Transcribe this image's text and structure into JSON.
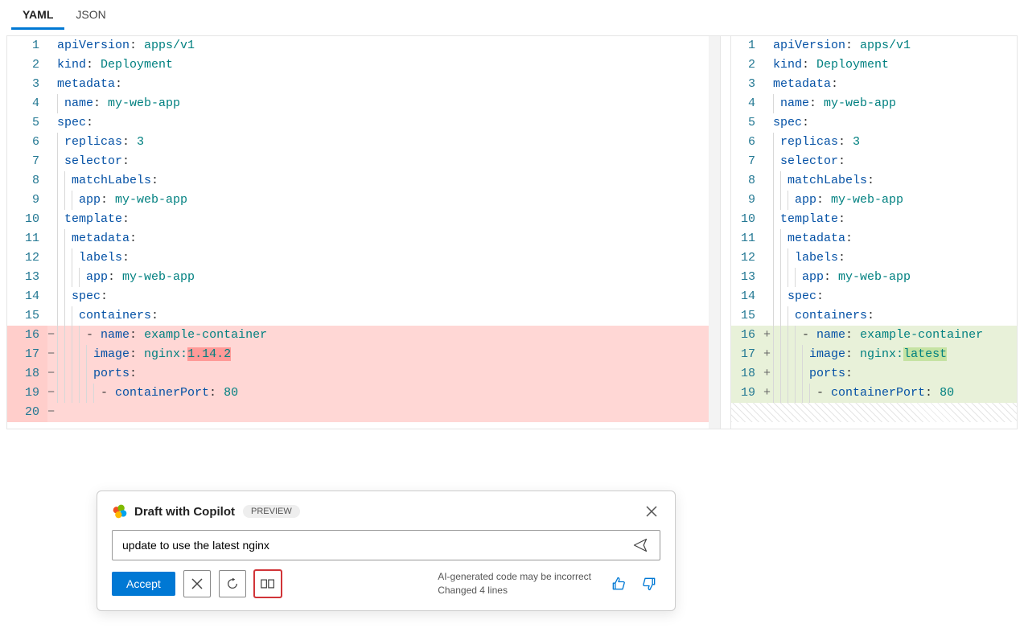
{
  "tabs": {
    "yaml": "YAML",
    "json": "JSON"
  },
  "left_pane": {
    "lines": [
      {
        "n": 1,
        "sign": "",
        "indent": 0,
        "segs": [
          {
            "t": "apiVersion",
            "c": "tok-key"
          },
          {
            "t": ":",
            "c": "tok-punct"
          },
          {
            "t": " "
          },
          {
            "t": "apps/v1",
            "c": "tok-scalar"
          }
        ]
      },
      {
        "n": 2,
        "sign": "",
        "indent": 0,
        "segs": [
          {
            "t": "kind",
            "c": "tok-key"
          },
          {
            "t": ":",
            "c": "tok-punct"
          },
          {
            "t": " "
          },
          {
            "t": "Deployment",
            "c": "tok-scalar"
          }
        ]
      },
      {
        "n": 3,
        "sign": "",
        "indent": 0,
        "segs": [
          {
            "t": "metadata",
            "c": "tok-key"
          },
          {
            "t": ":",
            "c": "tok-punct"
          }
        ]
      },
      {
        "n": 4,
        "sign": "",
        "indent": 1,
        "segs": [
          {
            "t": "name",
            "c": "tok-key"
          },
          {
            "t": ":",
            "c": "tok-punct"
          },
          {
            "t": " "
          },
          {
            "t": "my-web-app",
            "c": "tok-scalar"
          }
        ]
      },
      {
        "n": 5,
        "sign": "",
        "indent": 0,
        "segs": [
          {
            "t": "spec",
            "c": "tok-key"
          },
          {
            "t": ":",
            "c": "tok-punct"
          }
        ]
      },
      {
        "n": 6,
        "sign": "",
        "indent": 1,
        "segs": [
          {
            "t": "replicas",
            "c": "tok-key"
          },
          {
            "t": ":",
            "c": "tok-punct"
          },
          {
            "t": " "
          },
          {
            "t": "3",
            "c": "tok-scalar"
          }
        ]
      },
      {
        "n": 7,
        "sign": "",
        "indent": 1,
        "segs": [
          {
            "t": "selector",
            "c": "tok-key"
          },
          {
            "t": ":",
            "c": "tok-punct"
          }
        ]
      },
      {
        "n": 8,
        "sign": "",
        "indent": 2,
        "segs": [
          {
            "t": "matchLabels",
            "c": "tok-key"
          },
          {
            "t": ":",
            "c": "tok-punct"
          }
        ]
      },
      {
        "n": 9,
        "sign": "",
        "indent": 3,
        "segs": [
          {
            "t": "app",
            "c": "tok-key"
          },
          {
            "t": ":",
            "c": "tok-punct"
          },
          {
            "t": " "
          },
          {
            "t": "my-web-app",
            "c": "tok-scalar"
          }
        ]
      },
      {
        "n": 10,
        "sign": "",
        "indent": 1,
        "segs": [
          {
            "t": "template",
            "c": "tok-key"
          },
          {
            "t": ":",
            "c": "tok-punct"
          }
        ]
      },
      {
        "n": 11,
        "sign": "",
        "indent": 2,
        "segs": [
          {
            "t": "metadata",
            "c": "tok-key"
          },
          {
            "t": ":",
            "c": "tok-punct"
          }
        ]
      },
      {
        "n": 12,
        "sign": "",
        "indent": 3,
        "segs": [
          {
            "t": "labels",
            "c": "tok-key"
          },
          {
            "t": ":",
            "c": "tok-punct"
          }
        ]
      },
      {
        "n": 13,
        "sign": "",
        "indent": 4,
        "segs": [
          {
            "t": "app",
            "c": "tok-key"
          },
          {
            "t": ":",
            "c": "tok-punct"
          },
          {
            "t": " "
          },
          {
            "t": "my-web-app",
            "c": "tok-scalar"
          }
        ]
      },
      {
        "n": 14,
        "sign": "",
        "indent": 2,
        "segs": [
          {
            "t": "spec",
            "c": "tok-key"
          },
          {
            "t": ":",
            "c": "tok-punct"
          }
        ]
      },
      {
        "n": 15,
        "sign": "",
        "indent": 3,
        "segs": [
          {
            "t": "containers",
            "c": "tok-key"
          },
          {
            "t": ":",
            "c": "tok-punct"
          }
        ]
      },
      {
        "n": 16,
        "sign": "−",
        "indent": 4,
        "cls": "removed",
        "segs": [
          {
            "t": "- ",
            "c": "tok-dash"
          },
          {
            "t": "name",
            "c": "tok-key"
          },
          {
            "t": ":",
            "c": "tok-punct"
          },
          {
            "t": " "
          },
          {
            "t": "example-container",
            "c": "tok-scalar"
          }
        ]
      },
      {
        "n": 17,
        "sign": "−",
        "indent": 5,
        "cls": "removed",
        "segs": [
          {
            "t": "image",
            "c": "tok-key"
          },
          {
            "t": ":",
            "c": "tok-punct"
          },
          {
            "t": " "
          },
          {
            "t": "nginx:",
            "c": "tok-scalar"
          },
          {
            "t": "1.14.2",
            "c": "tok-scalar inline-del"
          }
        ]
      },
      {
        "n": 18,
        "sign": "−",
        "indent": 5,
        "cls": "removed",
        "segs": [
          {
            "t": "ports",
            "c": "tok-key"
          },
          {
            "t": ":",
            "c": "tok-punct"
          }
        ]
      },
      {
        "n": 19,
        "sign": "−",
        "indent": 6,
        "cls": "removed",
        "segs": [
          {
            "t": "- ",
            "c": "tok-dash"
          },
          {
            "t": "containerPort",
            "c": "tok-key"
          },
          {
            "t": ":",
            "c": "tok-punct"
          },
          {
            "t": " "
          },
          {
            "t": "80",
            "c": "tok-scalar"
          }
        ]
      },
      {
        "n": 20,
        "sign": "−",
        "indent": 0,
        "cls": "removed",
        "segs": []
      }
    ]
  },
  "right_pane": {
    "lines": [
      {
        "n": 1,
        "sign": "",
        "indent": 0,
        "segs": [
          {
            "t": "apiVersion",
            "c": "tok-key"
          },
          {
            "t": ":",
            "c": "tok-punct"
          },
          {
            "t": " "
          },
          {
            "t": "apps/v1",
            "c": "tok-scalar"
          }
        ]
      },
      {
        "n": 2,
        "sign": "",
        "indent": 0,
        "segs": [
          {
            "t": "kind",
            "c": "tok-key"
          },
          {
            "t": ":",
            "c": "tok-punct"
          },
          {
            "t": " "
          },
          {
            "t": "Deployment",
            "c": "tok-scalar"
          }
        ]
      },
      {
        "n": 3,
        "sign": "",
        "indent": 0,
        "segs": [
          {
            "t": "metadata",
            "c": "tok-key"
          },
          {
            "t": ":",
            "c": "tok-punct"
          }
        ]
      },
      {
        "n": 4,
        "sign": "",
        "indent": 1,
        "segs": [
          {
            "t": "name",
            "c": "tok-key"
          },
          {
            "t": ":",
            "c": "tok-punct"
          },
          {
            "t": " "
          },
          {
            "t": "my-web-app",
            "c": "tok-scalar"
          }
        ]
      },
      {
        "n": 5,
        "sign": "",
        "indent": 0,
        "segs": [
          {
            "t": "spec",
            "c": "tok-key"
          },
          {
            "t": ":",
            "c": "tok-punct"
          }
        ]
      },
      {
        "n": 6,
        "sign": "",
        "indent": 1,
        "segs": [
          {
            "t": "replicas",
            "c": "tok-key"
          },
          {
            "t": ":",
            "c": "tok-punct"
          },
          {
            "t": " "
          },
          {
            "t": "3",
            "c": "tok-scalar"
          }
        ]
      },
      {
        "n": 7,
        "sign": "",
        "indent": 1,
        "segs": [
          {
            "t": "selector",
            "c": "tok-key"
          },
          {
            "t": ":",
            "c": "tok-punct"
          }
        ]
      },
      {
        "n": 8,
        "sign": "",
        "indent": 2,
        "segs": [
          {
            "t": "matchLabels",
            "c": "tok-key"
          },
          {
            "t": ":",
            "c": "tok-punct"
          }
        ]
      },
      {
        "n": 9,
        "sign": "",
        "indent": 3,
        "segs": [
          {
            "t": "app",
            "c": "tok-key"
          },
          {
            "t": ":",
            "c": "tok-punct"
          },
          {
            "t": " "
          },
          {
            "t": "my-web-app",
            "c": "tok-scalar"
          }
        ]
      },
      {
        "n": 10,
        "sign": "",
        "indent": 1,
        "segs": [
          {
            "t": "template",
            "c": "tok-key"
          },
          {
            "t": ":",
            "c": "tok-punct"
          }
        ]
      },
      {
        "n": 11,
        "sign": "",
        "indent": 2,
        "segs": [
          {
            "t": "metadata",
            "c": "tok-key"
          },
          {
            "t": ":",
            "c": "tok-punct"
          }
        ]
      },
      {
        "n": 12,
        "sign": "",
        "indent": 3,
        "segs": [
          {
            "t": "labels",
            "c": "tok-key"
          },
          {
            "t": ":",
            "c": "tok-punct"
          }
        ]
      },
      {
        "n": 13,
        "sign": "",
        "indent": 4,
        "segs": [
          {
            "t": "app",
            "c": "tok-key"
          },
          {
            "t": ":",
            "c": "tok-punct"
          },
          {
            "t": " "
          },
          {
            "t": "my-web-app",
            "c": "tok-scalar"
          }
        ]
      },
      {
        "n": 14,
        "sign": "",
        "indent": 2,
        "segs": [
          {
            "t": "spec",
            "c": "tok-key"
          },
          {
            "t": ":",
            "c": "tok-punct"
          }
        ]
      },
      {
        "n": 15,
        "sign": "",
        "indent": 3,
        "segs": [
          {
            "t": "containers",
            "c": "tok-key"
          },
          {
            "t": ":",
            "c": "tok-punct"
          }
        ]
      },
      {
        "n": 16,
        "sign": "+",
        "indent": 4,
        "cls": "added",
        "segs": [
          {
            "t": "- ",
            "c": "tok-dash"
          },
          {
            "t": "name",
            "c": "tok-key"
          },
          {
            "t": ":",
            "c": "tok-punct"
          },
          {
            "t": " "
          },
          {
            "t": "example-container",
            "c": "tok-scalar"
          }
        ]
      },
      {
        "n": 17,
        "sign": "+",
        "indent": 5,
        "cls": "added",
        "segs": [
          {
            "t": "image",
            "c": "tok-key"
          },
          {
            "t": ":",
            "c": "tok-punct"
          },
          {
            "t": " "
          },
          {
            "t": "nginx:",
            "c": "tok-scalar"
          },
          {
            "t": "latest",
            "c": "tok-scalar inline-add"
          }
        ]
      },
      {
        "n": 18,
        "sign": "+",
        "indent": 5,
        "cls": "added",
        "segs": [
          {
            "t": "ports",
            "c": "tok-key"
          },
          {
            "t": ":",
            "c": "tok-punct"
          }
        ]
      },
      {
        "n": 19,
        "sign": "+",
        "indent": 6,
        "cls": "added",
        "segs": [
          {
            "t": "- ",
            "c": "tok-dash"
          },
          {
            "t": "containerPort",
            "c": "tok-key"
          },
          {
            "t": ":",
            "c": "tok-punct"
          },
          {
            "t": " "
          },
          {
            "t": "80",
            "c": "tok-scalar"
          }
        ]
      }
    ],
    "trailing_hatch_rows": 1
  },
  "copilot": {
    "title": "Draft with Copilot",
    "badge": "PREVIEW",
    "input_value": "update to use the latest nginx",
    "accept": "Accept",
    "info_line1": "AI-generated code may be incorrect",
    "info_line2": "Changed 4 lines"
  }
}
